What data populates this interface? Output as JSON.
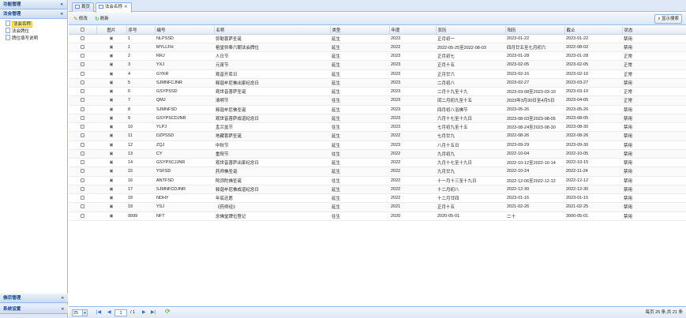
{
  "sidebar": {
    "top_header": "功能管理",
    "section_header": "法会管理",
    "items": [
      {
        "label": "法会名称",
        "selected": true
      },
      {
        "label": "法会牌位",
        "selected": false
      },
      {
        "label": "牌位填写说明",
        "selected": false
      }
    ],
    "bottom_headers": [
      "佛宗管理",
      "系统设置"
    ],
    "collapse_glyph": "«"
  },
  "tabs": [
    {
      "label": "首页",
      "active": false
    },
    {
      "label": "法会名称",
      "active": true,
      "close": "✕"
    }
  ],
  "toolbar": {
    "edit_label": "修改",
    "refresh_label": "刷新",
    "search_label": "显示搜索"
  },
  "grid": {
    "columns": [
      "",
      "图片",
      "序号",
      "编号",
      "名称",
      "类型",
      "年度",
      "农历",
      "阳历",
      "截止",
      "状态"
    ],
    "rows": [
      [
        "",
        "1",
        "NLPSSD",
        "弥勒菩萨圣诞",
        "延生",
        "2023",
        "正月初一",
        "2023-01-22",
        "2023-01-22",
        "禁用"
      ],
      [
        "",
        "1",
        "MYLLFH",
        "祖堂供奉六朝法会牌位",
        "延生",
        "2022",
        "2022-05-25至2022-08-03",
        "四月廿五至七月初六",
        "2022-08-02",
        "禁用"
      ],
      [
        "",
        "2",
        "RRJ",
        "人日节",
        "延生",
        "2023",
        "正月初七",
        "2023-01-28",
        "2023-01-28",
        "正常"
      ],
      [
        "",
        "3",
        "YXJ",
        "元宵节",
        "延生",
        "2023",
        "正月十五",
        "2023-02-05",
        "2023-02-05",
        "正常"
      ],
      [
        "",
        "4",
        "GYKR",
        "观音开库日",
        "延生",
        "2023",
        "正月廿六",
        "2023-02-16",
        "2023-02-16",
        "正常"
      ],
      [
        "",
        "5",
        "SJMNFCJNR",
        "释迦牟尼佛出家纪念日",
        "延生",
        "2023",
        "二月初八",
        "2023-02-27",
        "2023-03-27",
        "禁用"
      ],
      [
        "",
        "6",
        "GSYPSSD",
        "观世音菩萨圣诞",
        "延生",
        "2023",
        "二月十九至十九",
        "2023-03-08至2023-03-10",
        "2023-03-10",
        "正常"
      ],
      [
        "",
        "7",
        "QMJ",
        "清明节",
        "往生",
        "2023",
        "闰二月初九至十五",
        "2023年3月30日至4月5日",
        "2023-04-05",
        "正常"
      ],
      [
        "",
        "8",
        "SJMNFSD",
        "释迦牟尼佛圣诞",
        "延生",
        "2023",
        "四月初八浴佛节",
        "2023-05-26",
        "2023-05-26",
        "禁用"
      ],
      [
        "",
        "9",
        "GSYPSCDJNR",
        "观世音菩萨成道纪念日",
        "延生",
        "2023",
        "六月十七至十九日",
        "2023-08-03至2023-08-05",
        "2023-08-05",
        "禁用"
      ],
      [
        "",
        "10",
        "YLPJ",
        "盂兰盆节",
        "往生",
        "2023",
        "七月初九至十五",
        "2023-08-24至2023-08-30",
        "2023-08-30",
        "禁用"
      ],
      [
        "",
        "11",
        "DZPSSD",
        "地藏菩萨圣诞",
        "延生",
        "2022",
        "七月廿九",
        "2022-08-26",
        "2022-08-26",
        "禁用"
      ],
      [
        "",
        "12",
        "ZQJ",
        "中秋节",
        "延生",
        "2023",
        "八月十五日",
        "2023-09-29",
        "2023-09-30",
        "禁用"
      ],
      [
        "",
        "13",
        "CY",
        "重阳节",
        "往生",
        "2022",
        "九月初九",
        "2022-10-04",
        "2022-10-05",
        "禁用"
      ],
      [
        "",
        "14",
        "GSYPSCJJNR",
        "观世音菩萨出家纪念日",
        "延生",
        "2022",
        "九月十七至十九日",
        "2022-10-12至2022-10-14",
        "2022-10-15",
        "禁用"
      ],
      [
        "",
        "15",
        "YSFSD",
        "药师佛圣诞",
        "延生",
        "2022",
        "九月廿九",
        "2022-10-24",
        "2022-11-24",
        "禁用"
      ],
      [
        "",
        "16",
        "ANTFSD",
        "阿弥陀佛圣诞",
        "往生",
        "2022",
        "十一月十三至十九日",
        "2022-12-06至2022-12-12",
        "2022-12-12",
        "禁用"
      ],
      [
        "",
        "17",
        "SJMNFCDJNR",
        "释迦牟尼佛成道纪念日",
        "延生",
        "2022",
        "十二月初八",
        "2022-12-30",
        "2022-12-30",
        "禁用"
      ],
      [
        "",
        "18",
        "NDHY",
        "年底还愿",
        "延生",
        "2022",
        "十二月廿四",
        "2023-01-16",
        "2023-01-15",
        "禁用"
      ],
      [
        "",
        "19",
        "YSJ",
        "《药师经》",
        "延生",
        "2021",
        "正月十五",
        "2021-02-26",
        "2021-02-25",
        "禁用"
      ],
      [
        "",
        "9999",
        "NFT",
        "念佛堂牌位登记",
        "往生",
        "2020",
        "2020-05-01",
        "二十",
        "3000-05-01",
        "禁用"
      ]
    ]
  },
  "pager": {
    "page_size": "25",
    "page": "1",
    "of_pages": "/ 1",
    "info": "每页 25 条,共 21 条"
  }
}
